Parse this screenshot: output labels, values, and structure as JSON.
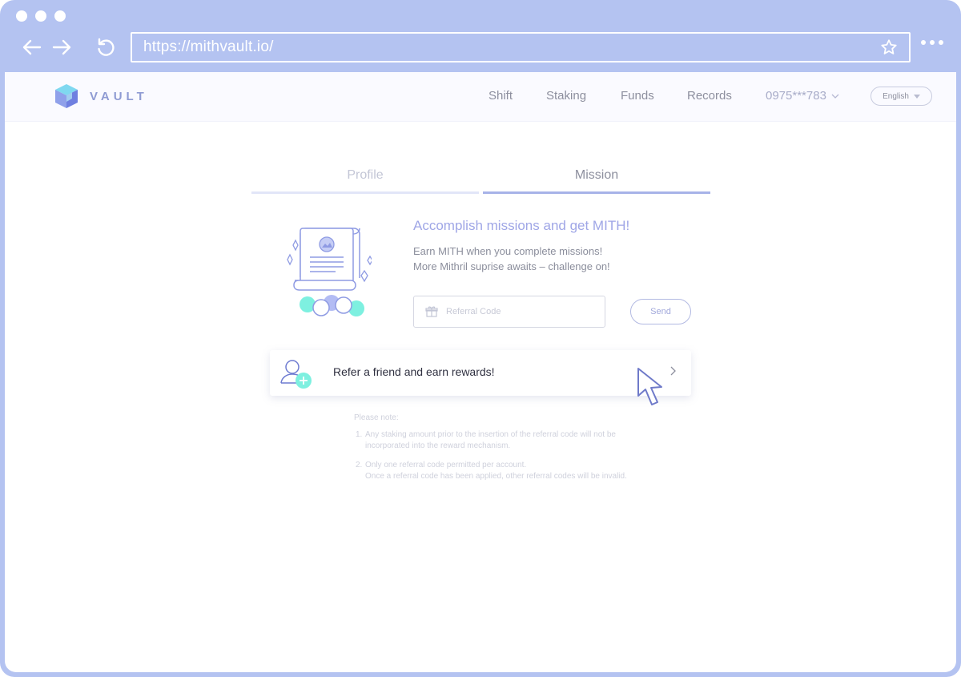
{
  "browser": {
    "url": "https://mithvault.io/"
  },
  "colors": {
    "frame": "#b4c3f1",
    "accent": "#9fa6e6",
    "mint": "#7ef0e0"
  },
  "header": {
    "logo_text": "VAULT",
    "nav": [
      "Shift",
      "Staking",
      "Funds",
      "Records"
    ],
    "account": "0975***783",
    "language": "English"
  },
  "tabs": {
    "profile": "Profile",
    "mission": "Mission",
    "active": "Mission"
  },
  "mission": {
    "headline": "Accomplish missions and get MITH!",
    "desc_line1": "Earn MITH when you complete missions!",
    "desc_line2": "More Mithril suprise awaits – challenge on!",
    "referral_placeholder": "Referral Code",
    "send_label": "Send",
    "refer_card_text": "Refer a friend and earn rewards!"
  },
  "notes": {
    "title": "Please note:",
    "items": [
      {
        "num": "1.",
        "line1": "Any staking amount prior to the insertion of the referral code will not be",
        "line2": "incorporated into the reward mechanism."
      },
      {
        "num": "2.",
        "line1": "Only one referral code permitted per account.",
        "line2": "Once a referral code has been applied, other referral codes will be invalid."
      }
    ]
  },
  "icons": [
    "back-arrow-icon",
    "forward-arrow-icon",
    "reload-icon",
    "star-icon",
    "more-icon",
    "vault-logo-icon",
    "chevron-down-icon",
    "gift-icon",
    "add-user-icon",
    "chevron-right-icon",
    "pointer-cursor-icon"
  ]
}
